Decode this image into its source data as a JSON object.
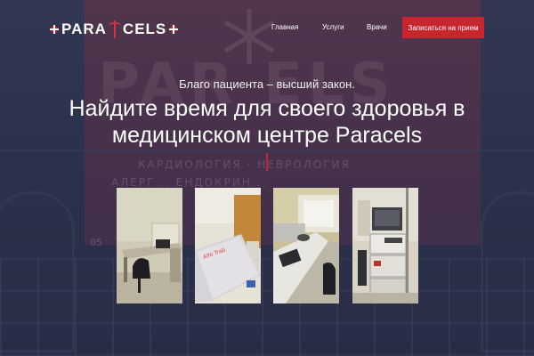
{
  "brand": {
    "logo_text_left": "PARA",
    "logo_text_right": "CELS",
    "accent_color": "#c8262f"
  },
  "nav": {
    "items": [
      {
        "label": "Главная"
      },
      {
        "label": "Услуги"
      },
      {
        "label": "Врачи"
      }
    ],
    "cta_label": "Записаться на прием"
  },
  "hero": {
    "tagline": "Благо пациента – высший закон.",
    "title": "Найдите время для своего здоровья в медицинском центре Paracels"
  },
  "photos": [
    {
      "icon": "office-desk-photo"
    },
    {
      "icon": "examination-couch-photo"
    },
    {
      "icon": "doctor-desk-photo"
    },
    {
      "icon": "medical-equipment-photo"
    }
  ]
}
